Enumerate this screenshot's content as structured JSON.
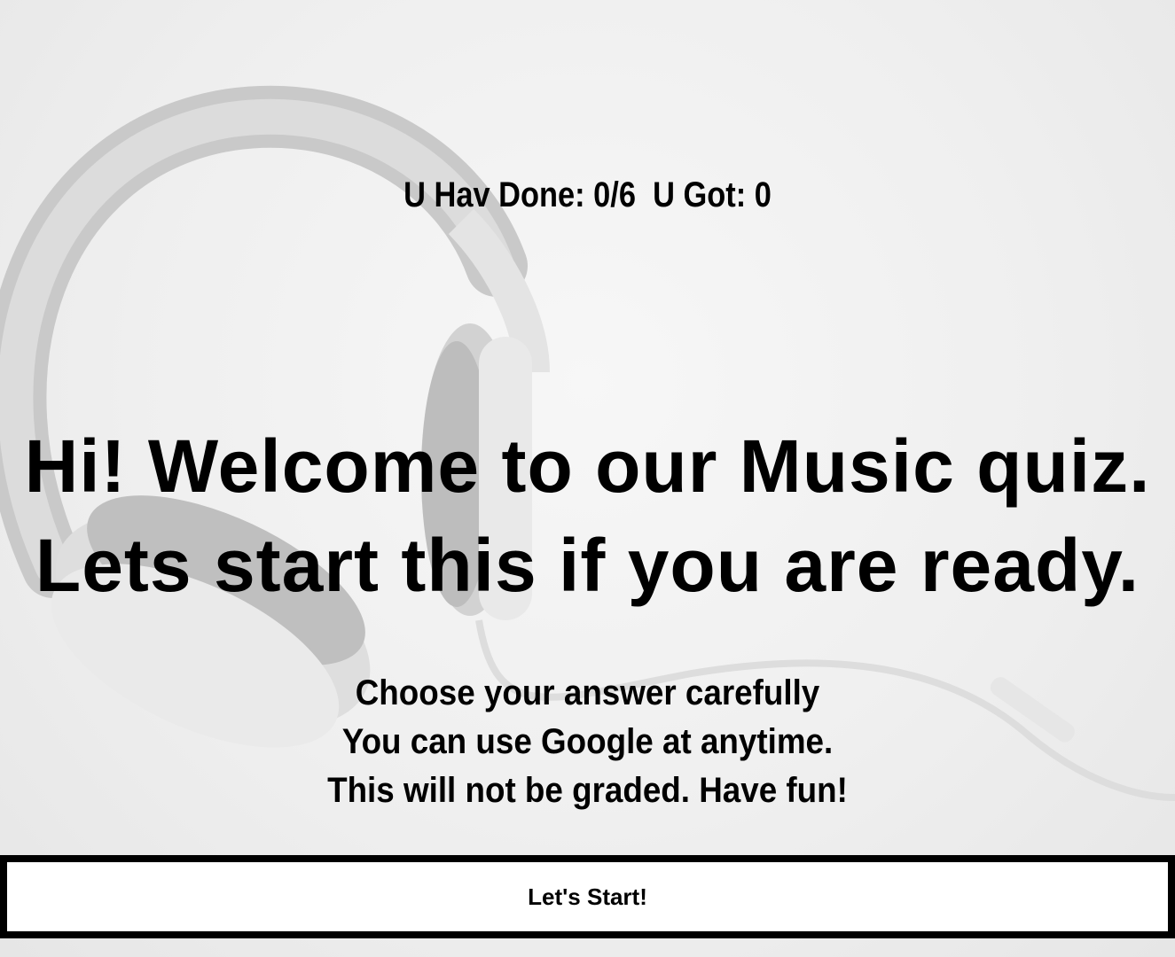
{
  "score": {
    "done_label": "U Hav Done:",
    "done_value": "0/6",
    "got_label": "U Got:",
    "got_value": "0"
  },
  "headline": {
    "line1": "Hi! Welcome to our Music quiz.",
    "line2": "Lets start this if you are ready."
  },
  "instructions": {
    "line1": "Choose your answer carefully",
    "line2": "You can use Google at anytime.",
    "line3": "This will not be graded. Have fun!"
  },
  "start_button": {
    "label": "Let's Start!"
  },
  "background": {
    "subject": "headphones-image",
    "color": "#efefef"
  }
}
